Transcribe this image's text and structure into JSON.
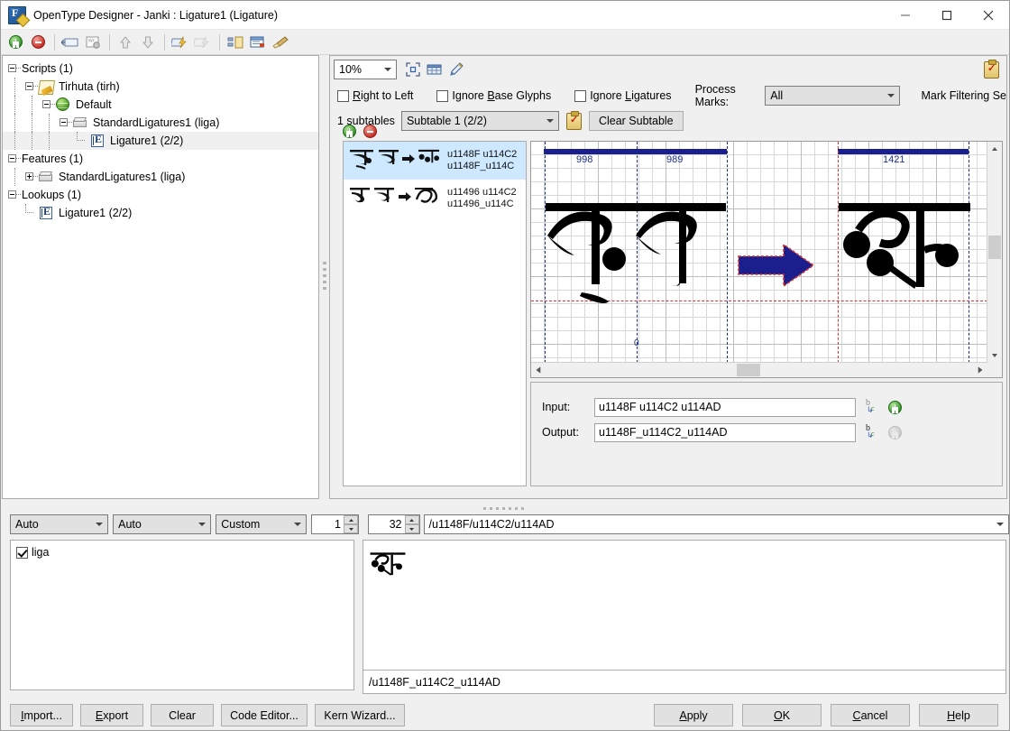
{
  "window": {
    "title": "OpenType Designer - Janki : Ligature1 (Ligature)",
    "app_icon": "opentype-designer-icon",
    "minimize": "–",
    "maximize": "□",
    "close": "✕"
  },
  "toolbar": {
    "items": [
      {
        "name": "add-icon",
        "glyph": "+"
      },
      {
        "name": "remove-icon",
        "glyph": "−"
      },
      {
        "name": "rename-icon",
        "glyph": "▭"
      },
      {
        "name": "xyz-glyph-icon",
        "glyph": "xyz"
      },
      {
        "name": "move-up-icon",
        "glyph": "⬆"
      },
      {
        "name": "move-down-icon",
        "glyph": "⬇"
      },
      {
        "name": "lightning-apply-icon",
        "glyph": "⚡"
      },
      {
        "name": "lightning-disabled-icon",
        "glyph": "⚡"
      },
      {
        "name": "copy-subtable-icon",
        "glyph": "⧉"
      },
      {
        "name": "edit-window-icon",
        "glyph": "▤"
      },
      {
        "name": "broom-clean-icon",
        "glyph": "🧹"
      }
    ]
  },
  "tree": {
    "nodes": [
      {
        "label": "Scripts (1)",
        "depth": 0,
        "icon": "none",
        "expander": "minus",
        "selected": false
      },
      {
        "label": "Tirhuta (tirh)",
        "depth": 1,
        "icon": "script-icon",
        "expander": "minus",
        "selected": false
      },
      {
        "label": "Default",
        "depth": 2,
        "icon": "globe-icon",
        "expander": "minus",
        "selected": false
      },
      {
        "label": "StandardLigatures1 (liga)",
        "depth": 3,
        "icon": "feature-box-icon",
        "expander": "minus",
        "selected": false
      },
      {
        "label": "Ligature1 (2/2)",
        "depth": 4,
        "icon": "lookup-icon",
        "expander": "leaf",
        "selected": true
      },
      {
        "label": "Features (1)",
        "depth": 0,
        "icon": "none",
        "expander": "minus",
        "selected": false
      },
      {
        "label": "StandardLigatures1 (liga)",
        "depth": 1,
        "icon": "feature-box-icon",
        "expander": "plus",
        "selected": false
      },
      {
        "label": "Lookups (1)",
        "depth": 0,
        "icon": "none",
        "expander": "minus",
        "selected": false
      },
      {
        "label": "Ligature1 (2/2)",
        "depth": 1,
        "icon": "lookup-icon",
        "expander": "leaf",
        "selected": false
      }
    ]
  },
  "lookup_panel": {
    "zoom": {
      "value": "10%",
      "options": [
        "10%"
      ]
    },
    "fit_icon": "fit-to-window-icon",
    "grid_icon": "grid-icon",
    "pen_icon": "pen-icon",
    "clipboard_icon": "clipboard-check-icon",
    "flags": [
      {
        "label": "Right to Left",
        "accel": "R",
        "checked": false,
        "name": "right-to-left-checkbox"
      },
      {
        "label": "Ignore Base Glyphs",
        "accel": "B",
        "checked": false,
        "name": "ignore-base-glyphs-checkbox"
      },
      {
        "label": "Ignore Ligatures",
        "accel": "L",
        "checked": false,
        "name": "ignore-ligatures-checkbox"
      }
    ],
    "process_marks_label": "Process Marks:",
    "process_marks_value": "All",
    "mark_filtering_label": "Mark Filtering Se",
    "subtables_count_label": "1 subtables",
    "subtable_value": "Subtable 1 (2/2)",
    "clear_subtable_label": "Clear Subtable"
  },
  "glyph_list": {
    "add_button": "add-rule-button",
    "remove_button": "remove-rule-button",
    "rows": [
      {
        "glyph_preview": "𑒏‍ ̰ 𑓂 ➡ 𑒏𑓂",
        "input_codes": "u1148F u114C2",
        "output_codes": "u1148F_u114C",
        "selected": true
      },
      {
        "glyph_preview": "𑒖 ̰ 𑓂 ➡ 𑒖𑓂",
        "input_codes": "u11496 u114C2",
        "output_codes": "u11496_u114C",
        "selected": false
      }
    ]
  },
  "canvas": {
    "advance_widths": [
      "998",
      "989",
      "1421"
    ],
    "arrow_name": "transform-arrow",
    "scroll_up": "▲",
    "scroll_down": "▼",
    "scroll_left": "‹",
    "scroll_right": "›"
  },
  "io": {
    "input_label": "Input:",
    "input_value": "u1148F u114C2 u114AD",
    "output_label": "Output:",
    "output_value": "u1148F_u114C2_u114AD",
    "input_picker_icon": "glyph-picker-icon",
    "output_picker_icon": "glyph-picker-icon",
    "input_add_icon": "add-green-icon",
    "output_add_icon": "add-disabled-icon"
  },
  "bottom_controls": {
    "select1": "Auto",
    "select2": "Auto",
    "select3": "Custom",
    "spin1": "1",
    "spin2": "32",
    "text_combo": "/u1148F/u114C2/u114AD"
  },
  "features": {
    "items": [
      {
        "label": "liga",
        "checked": true
      }
    ]
  },
  "preview": {
    "glyph": "𑒏𑓂𑒨",
    "status_text": "/u1148F_u114C2_u114AD"
  },
  "buttons": {
    "left": [
      {
        "label": "Import...",
        "accel": "I",
        "name": "import-button"
      },
      {
        "label": "Export",
        "accel": "E",
        "name": "export-button"
      },
      {
        "label": "Clear",
        "accel": "",
        "name": "clear-button"
      },
      {
        "label": "Code Editor...",
        "accel": "",
        "name": "code-editor-button"
      },
      {
        "label": "Kern Wizard...",
        "accel": "",
        "name": "kern-wizard-button"
      }
    ],
    "right": [
      {
        "label": "Apply",
        "accel": "A",
        "name": "apply-button"
      },
      {
        "label": "OK",
        "accel": "O",
        "name": "ok-button"
      },
      {
        "label": "Cancel",
        "accel": "C",
        "name": "cancel-button"
      },
      {
        "label": "Help",
        "accel": "H",
        "name": "help-button"
      }
    ]
  },
  "colors": {
    "accent_blue": "#1b1f8e",
    "selection_blue": "#cde8ff",
    "baseline_red": "#e03030",
    "chrome_gray": "#f0f0f0"
  }
}
